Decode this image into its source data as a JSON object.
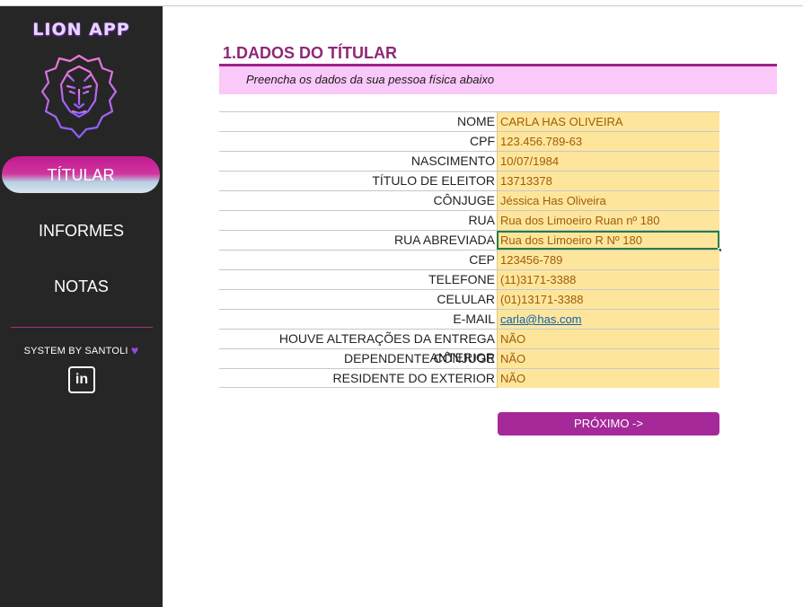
{
  "app": {
    "logo_text": "LION APP"
  },
  "sidebar": {
    "items": [
      {
        "label": "TÍTULAR",
        "active": true
      },
      {
        "label": "INFORMES",
        "active": false
      },
      {
        "label": "NOTAS",
        "active": false
      }
    ],
    "credit": "SYSTEM BY SANTOLI",
    "heart_glyph": "♥",
    "linkedin_text": "in"
  },
  "section": {
    "title": "1.DADOS DO TÍTULAR",
    "subtitle": "Preencha os dados da sua pessoa física abaixo"
  },
  "form": {
    "fields": [
      {
        "label": "NOME",
        "value": "CARLA HAS OLIVEIRA"
      },
      {
        "label": "CPF",
        "value": "123.456.789-63"
      },
      {
        "label": "NASCIMENTO",
        "value": "10/07/1984"
      },
      {
        "label": "TÍTULO DE ELEITOR",
        "value": "13713378"
      },
      {
        "label": "CÔNJUGE",
        "value": "Jéssica Has Oliveira"
      },
      {
        "label": "RUA",
        "value": "Rua dos Limoeiro Ruan nº 180"
      },
      {
        "label": "RUA ABREVIADA",
        "value": "Rua dos Limoeiro R Nº 180"
      },
      {
        "label": "CEP",
        "value": "123456-789"
      },
      {
        "label": "TELEFONE",
        "value": "(11)3171-3388"
      },
      {
        "label": "CELULAR",
        "value": "(01)13171-3388"
      },
      {
        "label": "E-MAIL",
        "value": "carla@has.com"
      },
      {
        "label": "HOUVE ALTERAÇÕES DA ENTREGA ANTERIOR",
        "value": "NÃO"
      },
      {
        "label": "DEPENDENTE CÔNJUGE",
        "value": "NÃO"
      },
      {
        "label": "RESIDENTE DO EXTERIOR",
        "value": "NÃO"
      }
    ],
    "next_label": "PRÓXIMO ->"
  },
  "colors": {
    "sidebar_bg": "#262626",
    "accent": "#a6299a",
    "title": "#8e2877",
    "subtitle_band": "#fbc8fa",
    "value_bg": "#fde69c",
    "value_text": "#a05c0a"
  },
  "icons": [
    "lion-logo-icon",
    "heart-icon",
    "linkedin-icon"
  ]
}
